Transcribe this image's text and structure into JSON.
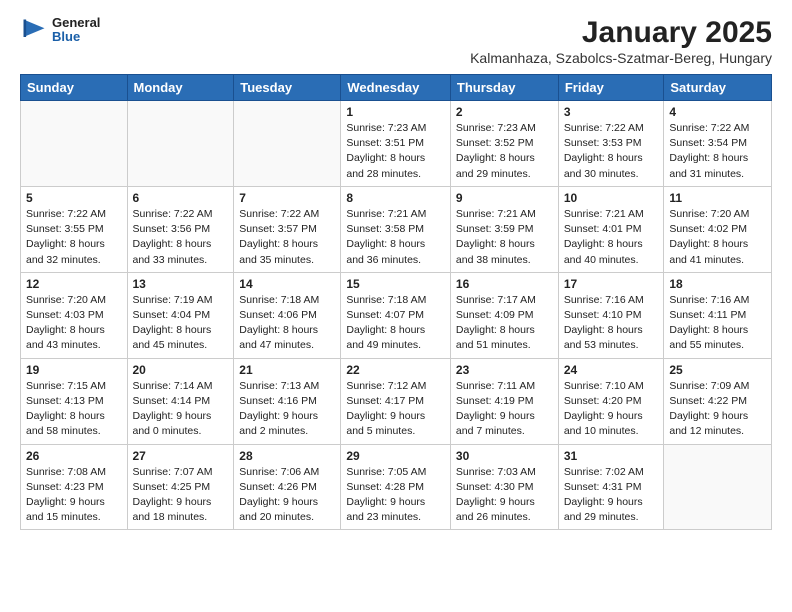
{
  "header": {
    "logo_general": "General",
    "logo_blue": "Blue",
    "title": "January 2025",
    "subtitle": "Kalmanhaza, Szabolcs-Szatmar-Bereg, Hungary"
  },
  "days_of_week": [
    "Sunday",
    "Monday",
    "Tuesday",
    "Wednesday",
    "Thursday",
    "Friday",
    "Saturday"
  ],
  "weeks": [
    [
      {
        "day": "",
        "info": ""
      },
      {
        "day": "",
        "info": ""
      },
      {
        "day": "",
        "info": ""
      },
      {
        "day": "1",
        "info": "Sunrise: 7:23 AM\nSunset: 3:51 PM\nDaylight: 8 hours\nand 28 minutes."
      },
      {
        "day": "2",
        "info": "Sunrise: 7:23 AM\nSunset: 3:52 PM\nDaylight: 8 hours\nand 29 minutes."
      },
      {
        "day": "3",
        "info": "Sunrise: 7:22 AM\nSunset: 3:53 PM\nDaylight: 8 hours\nand 30 minutes."
      },
      {
        "day": "4",
        "info": "Sunrise: 7:22 AM\nSunset: 3:54 PM\nDaylight: 8 hours\nand 31 minutes."
      }
    ],
    [
      {
        "day": "5",
        "info": "Sunrise: 7:22 AM\nSunset: 3:55 PM\nDaylight: 8 hours\nand 32 minutes."
      },
      {
        "day": "6",
        "info": "Sunrise: 7:22 AM\nSunset: 3:56 PM\nDaylight: 8 hours\nand 33 minutes."
      },
      {
        "day": "7",
        "info": "Sunrise: 7:22 AM\nSunset: 3:57 PM\nDaylight: 8 hours\nand 35 minutes."
      },
      {
        "day": "8",
        "info": "Sunrise: 7:21 AM\nSunset: 3:58 PM\nDaylight: 8 hours\nand 36 minutes."
      },
      {
        "day": "9",
        "info": "Sunrise: 7:21 AM\nSunset: 3:59 PM\nDaylight: 8 hours\nand 38 minutes."
      },
      {
        "day": "10",
        "info": "Sunrise: 7:21 AM\nSunset: 4:01 PM\nDaylight: 8 hours\nand 40 minutes."
      },
      {
        "day": "11",
        "info": "Sunrise: 7:20 AM\nSunset: 4:02 PM\nDaylight: 8 hours\nand 41 minutes."
      }
    ],
    [
      {
        "day": "12",
        "info": "Sunrise: 7:20 AM\nSunset: 4:03 PM\nDaylight: 8 hours\nand 43 minutes."
      },
      {
        "day": "13",
        "info": "Sunrise: 7:19 AM\nSunset: 4:04 PM\nDaylight: 8 hours\nand 45 minutes."
      },
      {
        "day": "14",
        "info": "Sunrise: 7:18 AM\nSunset: 4:06 PM\nDaylight: 8 hours\nand 47 minutes."
      },
      {
        "day": "15",
        "info": "Sunrise: 7:18 AM\nSunset: 4:07 PM\nDaylight: 8 hours\nand 49 minutes."
      },
      {
        "day": "16",
        "info": "Sunrise: 7:17 AM\nSunset: 4:09 PM\nDaylight: 8 hours\nand 51 minutes."
      },
      {
        "day": "17",
        "info": "Sunrise: 7:16 AM\nSunset: 4:10 PM\nDaylight: 8 hours\nand 53 minutes."
      },
      {
        "day": "18",
        "info": "Sunrise: 7:16 AM\nSunset: 4:11 PM\nDaylight: 8 hours\nand 55 minutes."
      }
    ],
    [
      {
        "day": "19",
        "info": "Sunrise: 7:15 AM\nSunset: 4:13 PM\nDaylight: 8 hours\nand 58 minutes."
      },
      {
        "day": "20",
        "info": "Sunrise: 7:14 AM\nSunset: 4:14 PM\nDaylight: 9 hours\nand 0 minutes."
      },
      {
        "day": "21",
        "info": "Sunrise: 7:13 AM\nSunset: 4:16 PM\nDaylight: 9 hours\nand 2 minutes."
      },
      {
        "day": "22",
        "info": "Sunrise: 7:12 AM\nSunset: 4:17 PM\nDaylight: 9 hours\nand 5 minutes."
      },
      {
        "day": "23",
        "info": "Sunrise: 7:11 AM\nSunset: 4:19 PM\nDaylight: 9 hours\nand 7 minutes."
      },
      {
        "day": "24",
        "info": "Sunrise: 7:10 AM\nSunset: 4:20 PM\nDaylight: 9 hours\nand 10 minutes."
      },
      {
        "day": "25",
        "info": "Sunrise: 7:09 AM\nSunset: 4:22 PM\nDaylight: 9 hours\nand 12 minutes."
      }
    ],
    [
      {
        "day": "26",
        "info": "Sunrise: 7:08 AM\nSunset: 4:23 PM\nDaylight: 9 hours\nand 15 minutes."
      },
      {
        "day": "27",
        "info": "Sunrise: 7:07 AM\nSunset: 4:25 PM\nDaylight: 9 hours\nand 18 minutes."
      },
      {
        "day": "28",
        "info": "Sunrise: 7:06 AM\nSunset: 4:26 PM\nDaylight: 9 hours\nand 20 minutes."
      },
      {
        "day": "29",
        "info": "Sunrise: 7:05 AM\nSunset: 4:28 PM\nDaylight: 9 hours\nand 23 minutes."
      },
      {
        "day": "30",
        "info": "Sunrise: 7:03 AM\nSunset: 4:30 PM\nDaylight: 9 hours\nand 26 minutes."
      },
      {
        "day": "31",
        "info": "Sunrise: 7:02 AM\nSunset: 4:31 PM\nDaylight: 9 hours\nand 29 minutes."
      },
      {
        "day": "",
        "info": ""
      }
    ]
  ]
}
